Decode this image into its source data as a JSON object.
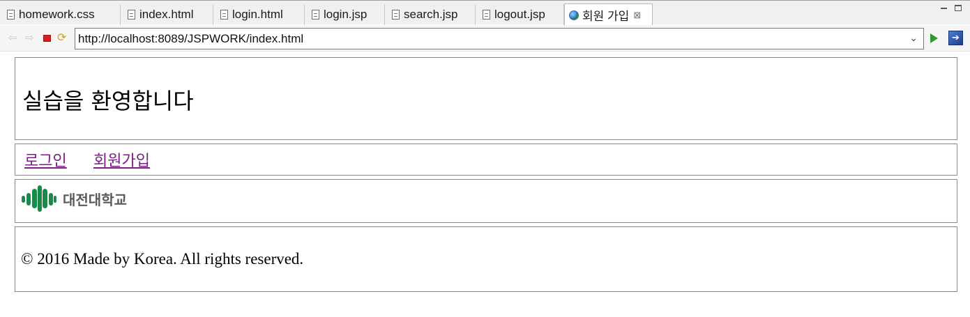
{
  "tabs": [
    {
      "label": "homework.css",
      "icon": "file-icon"
    },
    {
      "label": "index.html",
      "icon": "file-icon"
    },
    {
      "label": "login.html",
      "icon": "file-icon"
    },
    {
      "label": "login.jsp",
      "icon": "file-icon"
    },
    {
      "label": "search.jsp",
      "icon": "file-icon"
    },
    {
      "label": "logout.jsp",
      "icon": "file-icon"
    },
    {
      "label": "회원 가입",
      "icon": "globe-icon",
      "active": true,
      "close": "⊠"
    }
  ],
  "toolbar": {
    "url": "http://localhost:8089/JSPWORK/index.html",
    "back_icon": "⇦",
    "forward_icon": "⇨",
    "refresh_icon": "⟳",
    "dropdown_icon": "⌄",
    "external_icon": "➔"
  },
  "page": {
    "title": "실습을 환영합니다",
    "nav": {
      "login": "로그인",
      "join": "회원가입"
    },
    "logo": {
      "text": "대전대학교",
      "color": "#1a8a4a"
    },
    "footer": "© 2016 Made by Korea. All rights reserved."
  },
  "colors": {
    "link_visited": "#7b1f86",
    "go_green": "#2e9a2e",
    "stop_red": "#d81e1e"
  }
}
